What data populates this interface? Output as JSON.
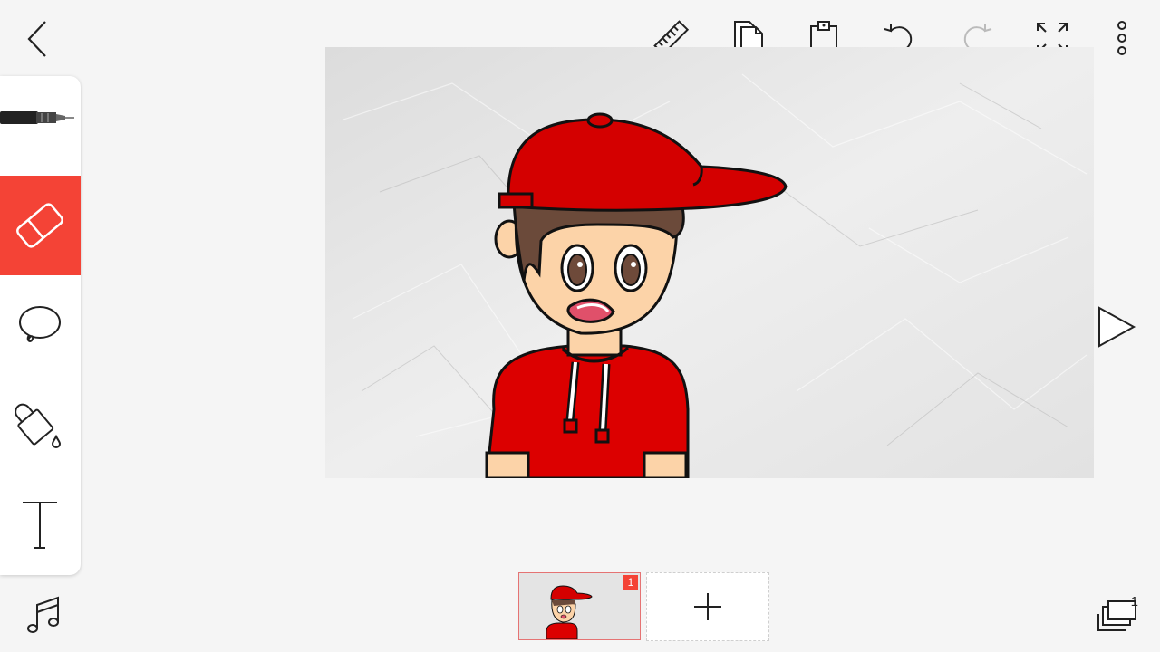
{
  "toolbar": {
    "back": "back-chevron-icon",
    "actions": [
      "ruler-icon",
      "copy-icon",
      "paste-icon",
      "undo-icon",
      "redo-icon",
      "fit-screen-icon",
      "more-vertical-icon"
    ]
  },
  "tools": {
    "items": [
      "pen-icon",
      "eraser-icon",
      "lasso-icon",
      "fill-bucket-icon",
      "text-icon"
    ],
    "active": "eraser"
  },
  "timeline": {
    "frame_number": "1",
    "add_label": "+"
  },
  "layers": {
    "count": "1"
  },
  "colors": {
    "accent": "#f44336",
    "cap": "#d40000",
    "hair": "#6b4a3a",
    "skin": "#fcd3a8",
    "shirt": "#dc0000"
  }
}
